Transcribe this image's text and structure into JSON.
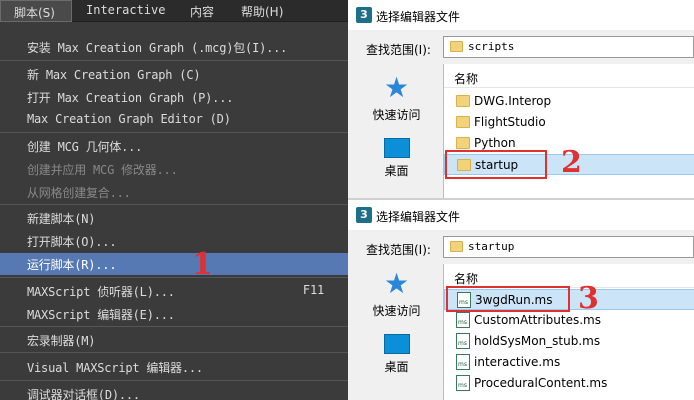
{
  "menubar": {
    "script": "脚本(S)",
    "interactive": "Interactive",
    "content": "内容",
    "help": "帮助(H)"
  },
  "menu": {
    "items": [
      {
        "label": "安装 Max Creation Graph (.mcg)包(I)..."
      },
      {
        "label": "新 Max Creation Graph (C)"
      },
      {
        "label": "打开 Max Creation Graph (P)..."
      },
      {
        "label": "Max Creation Graph Editor (D)"
      },
      {
        "label": "创建 MCG 几何体..."
      },
      {
        "label": "创建并应用 MCG 修改器..."
      },
      {
        "label": "从网格创建复合..."
      },
      {
        "label": "新建脚本(N)"
      },
      {
        "label": "打开脚本(O)..."
      },
      {
        "label": "运行脚本(R)..."
      },
      {
        "label": "MAXScript 侦听器(L)...",
        "shortcut": "F11"
      },
      {
        "label": "MAXScript 编辑器(E)..."
      },
      {
        "label": "宏录制器(M)"
      },
      {
        "label": "Visual MAXScript 编辑器..."
      },
      {
        "label": "调试器对话框(D)..."
      }
    ]
  },
  "dialog1": {
    "title": "选择编辑器文件",
    "look_in_label": "查找范围(I):",
    "look_in_value": "scripts",
    "places": [
      {
        "label": "快速访问"
      },
      {
        "label": "桌面"
      }
    ],
    "column_header": "名称",
    "files": [
      "DWG.Interop",
      "FlightStudio",
      "Python",
      "startup"
    ]
  },
  "dialog2": {
    "title": "选择编辑器文件",
    "look_in_label": "查找范围(I):",
    "look_in_value": "startup",
    "places": [
      {
        "label": "快速访问"
      },
      {
        "label": "桌面"
      }
    ],
    "column_header": "名称",
    "files": [
      "3wgdRun.ms",
      "CustomAttributes.ms",
      "holdSysMon_stub.ms",
      "interactive.ms",
      "ProceduralContent.ms"
    ]
  },
  "annotations": {
    "step1": "1",
    "step2": "2",
    "step3": "3"
  },
  "colors": {
    "menu_bg": "#3b3b3b",
    "highlight": "#5679b3",
    "callout": "#e03030",
    "selection": "#cce4f7"
  }
}
